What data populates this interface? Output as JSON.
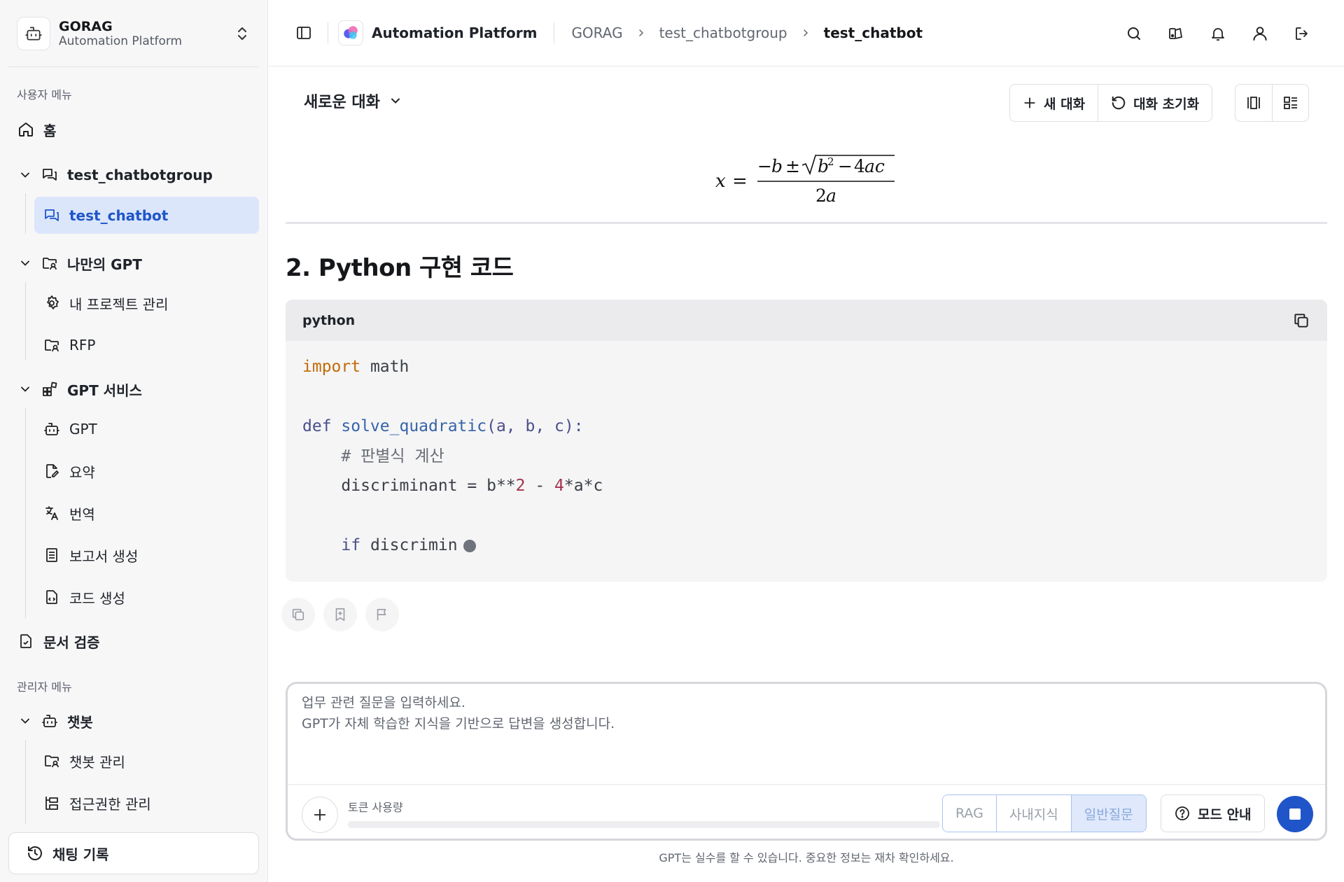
{
  "sidebar": {
    "brand_title": "GORAG",
    "brand_subtitle": "Automation Platform",
    "user_menu_label": "사용자 메뉴",
    "admin_menu_label": "관리자 메뉴",
    "home": "홈",
    "group_chatbot": "test_chatbotgroup",
    "item_chatbot": "test_chatbot",
    "my_gpt": "나만의 GPT",
    "my_project": "내 프로젝트 관리",
    "rfp": "RFP",
    "gpt_service": "GPT 서비스",
    "gpt": "GPT",
    "summary": "요약",
    "translate": "번역",
    "report": "보고서 생성",
    "codegen": "코드 생성",
    "doc_verify": "문서 검증",
    "chatbot": "챗봇",
    "chatbot_manage": "챗봇 관리",
    "access_manage": "접근권한 관리",
    "history": "채팅 기록"
  },
  "header": {
    "app_name": "Automation Platform",
    "breadcrumb": [
      "GORAG",
      "test_chatbotgroup",
      "test_chatbot"
    ]
  },
  "conversation": {
    "title": "새로운 대화",
    "new_chat": "새 대화",
    "reset_chat": "대화 초기화"
  },
  "content": {
    "heading": "2. Python 구현 코드",
    "code_lang": "python",
    "code": {
      "l1_kw": "import",
      "l1_rest": " math",
      "l3_def": "def",
      "l3_fn": " solve_quadratic",
      "l3_args": "(a, b, c):",
      "l4_comment": "    # 판별식 계산",
      "l5_a": "    discriminant = b**",
      "l5_n1": "2",
      "l5_b": " - ",
      "l5_n2": "4",
      "l5_c": "*a*c",
      "l7_if": "    if",
      "l7_rest": " discrimin"
    }
  },
  "composer": {
    "placeholder_line1": "업무 관련 질문을 입력하세요.",
    "placeholder_line2": "GPT가 자체 학습한 지식을 기반으로 답변을 생성합니다.",
    "token_label": "토큰 사용량",
    "token_usage": 0,
    "modes": [
      "RAG",
      "사내지식",
      "일반질문"
    ],
    "selected_mode": "일반질문",
    "mode_guide": "모드 안내",
    "disclaimer": "GPT는 실수를 할 수 있습니다. 중요한 정보는 재차 확인하세요."
  },
  "colors": {
    "accent": "#1f55c8",
    "active_bg": "#dbe6fb"
  }
}
